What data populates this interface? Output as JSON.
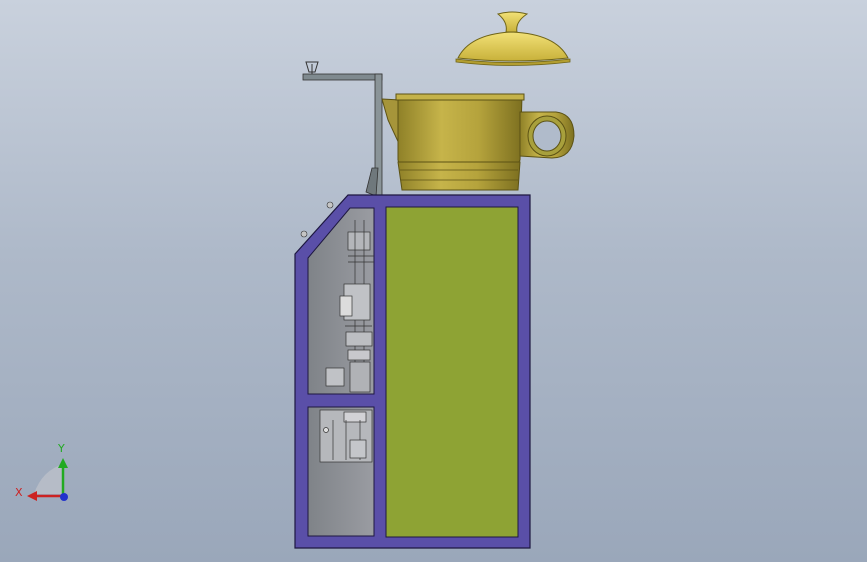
{
  "viewport": {
    "background_top": "#c9d1dd",
    "background_bottom": "#9aa7ba"
  },
  "model": {
    "cabinet_frame_color": "#5a4fa8",
    "cabinet_panel_color": "#8ea334",
    "mechanism_bay_color": "#8e9096",
    "teapot_color": "#b9a740",
    "lid_color": "#e4d05a",
    "bracket_color": "#7f8a8f"
  },
  "triad": {
    "x_label": "X",
    "y_label": "Y",
    "x_color": "#cc2222",
    "y_color": "#22aa22",
    "z_color": "#2233cc"
  }
}
